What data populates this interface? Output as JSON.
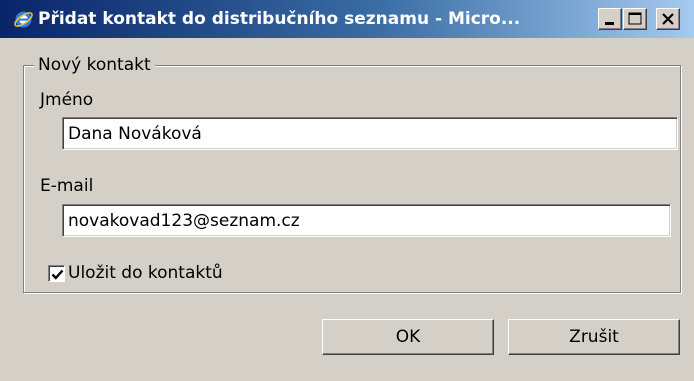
{
  "window": {
    "title": "Přidat kontakt do distribučního seznamu - Micro...",
    "icons": {
      "app": "internet-explorer-icon",
      "minimize": "minimize-icon",
      "maximize": "maximize-icon",
      "close": "close-icon"
    }
  },
  "form": {
    "group_label": "Nový kontakt",
    "name_label": "Jméno",
    "name_value": "Dana Nováková",
    "email_label": "E-mail",
    "email_value": "novakovad123@seznam.cz",
    "save_checkbox_label": "Uložit do kontaktů",
    "save_checkbox_checked": true
  },
  "buttons": {
    "ok_label": "OK",
    "cancel_label": "Zrušit"
  },
  "colors": {
    "titlebar_start": "#0a246a",
    "titlebar_end": "#a6caf0",
    "window_bg": "#d4d0c8"
  }
}
